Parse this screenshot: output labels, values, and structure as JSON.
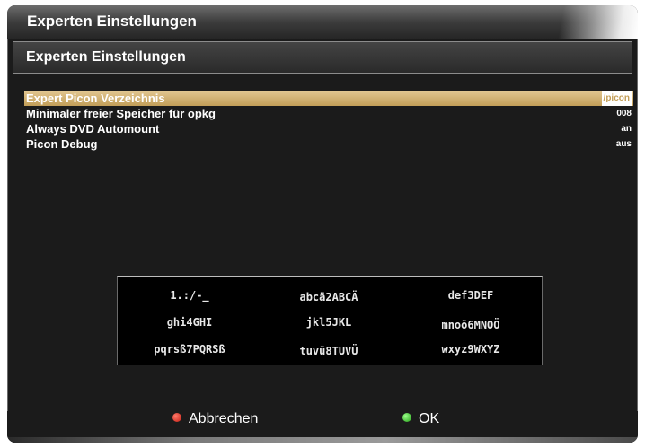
{
  "window": {
    "title": "Experten Einstellungen"
  },
  "subheader": {
    "title": "Experten Einstellungen"
  },
  "settings": [
    {
      "label": "Expert Picon Verzeichnis",
      "value": "/picon",
      "selected": true
    },
    {
      "label": "Minimaler freier Speicher für opkg",
      "value": "008",
      "selected": false
    },
    {
      "label": "Always DVD Automount",
      "value": "an",
      "selected": false
    },
    {
      "label": "Picon Debug",
      "value": "aus",
      "selected": false
    }
  ],
  "keypad": {
    "rows": [
      [
        "1.:/-_",
        "abcä2ABCÄ",
        "def3DEF"
      ],
      [
        "ghi4GHI",
        "jkl5JKL",
        "mnoö6MNOÖ"
      ],
      [
        "pqrsß7PQRSß",
        "tuvü8TUVÜ",
        "wxyz9WXYZ"
      ]
    ]
  },
  "buttons": {
    "cancel": {
      "label": "Abbrechen",
      "color": "#d8231a"
    },
    "ok": {
      "label": "OK",
      "color": "#2fbf1f"
    }
  },
  "colors": {
    "selection": "#c9a564",
    "background": "#1b1b1b"
  }
}
